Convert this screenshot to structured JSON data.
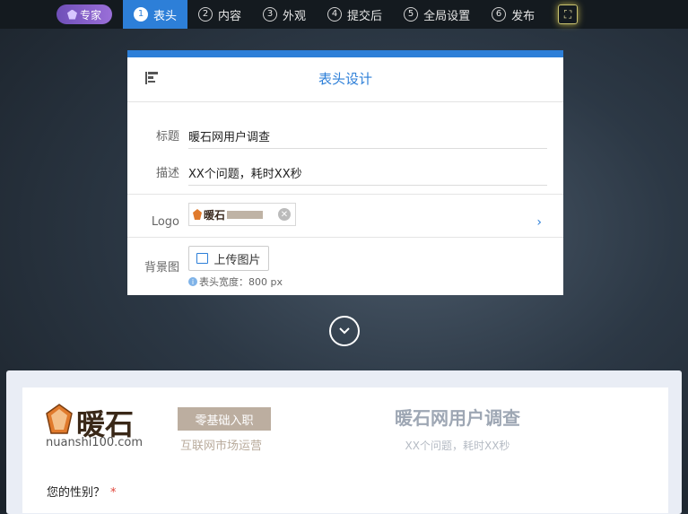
{
  "topbar": {
    "expert_label": "专家",
    "steps": [
      {
        "num": "1",
        "label": "表头"
      },
      {
        "num": "2",
        "label": "内容"
      },
      {
        "num": "3",
        "label": "外观"
      },
      {
        "num": "4",
        "label": "提交后"
      },
      {
        "num": "5",
        "label": "全局设置"
      },
      {
        "num": "6",
        "label": "发布"
      }
    ],
    "active_step": 1,
    "fullscreen_icon": "fullscreen-icon"
  },
  "panel": {
    "title": "表头设计",
    "fields": {
      "title_label": "标题",
      "title_value": "暖石网用户调查",
      "desc_label": "描述",
      "desc_value": "XX个问题，耗时XX秒",
      "logo_label": "Logo",
      "logo_brand": "暖石",
      "bg_label": "背景图",
      "upload_label": "上传图片",
      "hint": "表头宽度：800 px"
    }
  },
  "preview": {
    "brand_name": "暖石",
    "brand_url": "nuanshi100.com",
    "brand_tag": "零基础入职",
    "brand_sub": "互联网市场运营",
    "title": "暖石网用户调查",
    "desc": "XX个问题，耗时XX秒",
    "question": "您的性别？",
    "required_mark": "*"
  },
  "colors": {
    "accent": "#2d7fd8",
    "expert": "#8a5fd0",
    "required": "#e0453a"
  }
}
